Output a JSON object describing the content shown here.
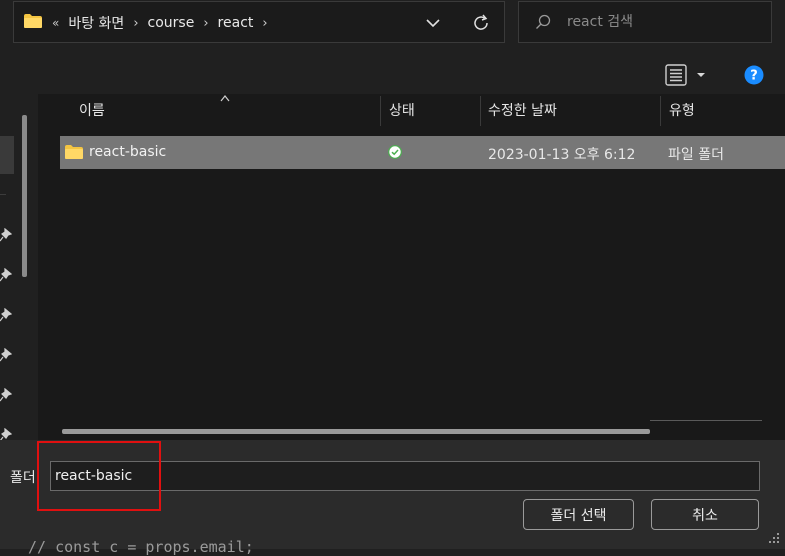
{
  "address_bar": {
    "overflow": "«",
    "crumbs": [
      "바탕 화면",
      "course",
      "react"
    ]
  },
  "search": {
    "placeholder": "react 검색"
  },
  "columns": {
    "name": "이름",
    "status": "상태",
    "modified": "수정한 날짜",
    "type": "유형"
  },
  "files": [
    {
      "name": "react-basic",
      "status": "synced-check-icon",
      "modified": "2023-01-13 오후 6:12",
      "type": "파일 폴더"
    }
  ],
  "bottom": {
    "folder_label": "폴더:",
    "folder_value": "react-basic",
    "select_button": "폴더 선택",
    "cancel_button": "취소"
  },
  "background_text": "// const c = props.email;",
  "colors": {
    "folder": "#f4c542",
    "selection": "#777777",
    "highlight_box": "#e01010",
    "help": "#1a8cff",
    "status_ok": "#4caf50"
  }
}
